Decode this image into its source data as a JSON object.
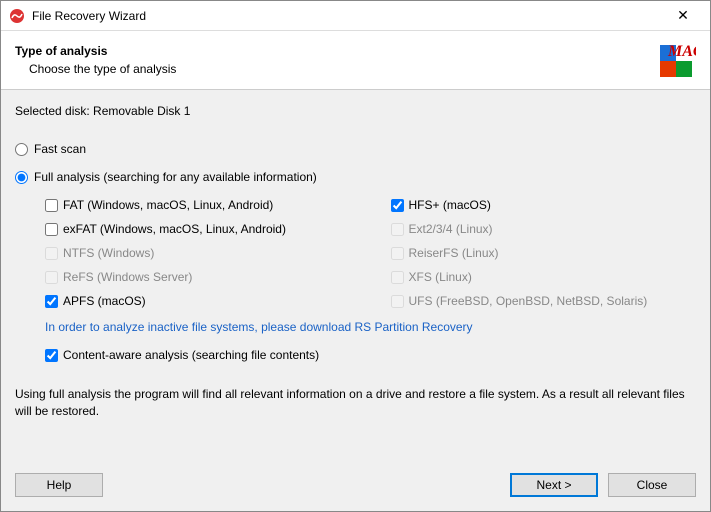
{
  "window": {
    "title": "File Recovery Wizard",
    "close_glyph": "✕"
  },
  "header": {
    "title": "Type of analysis",
    "subtitle": "Choose the type of analysis"
  },
  "selected_disk_label": "Selected disk: Removable Disk 1",
  "scan": {
    "fast_label": "Fast scan",
    "full_label": "Full analysis (searching for any available information)"
  },
  "filesystems": [
    {
      "label": "FAT (Windows, macOS, Linux, Android)",
      "checked": false,
      "disabled": false
    },
    {
      "label": "HFS+ (macOS)",
      "checked": true,
      "disabled": false
    },
    {
      "label": "exFAT (Windows, macOS, Linux, Android)",
      "checked": false,
      "disabled": false
    },
    {
      "label": "Ext2/3/4 (Linux)",
      "checked": false,
      "disabled": true
    },
    {
      "label": "NTFS (Windows)",
      "checked": false,
      "disabled": true
    },
    {
      "label": "ReiserFS (Linux)",
      "checked": false,
      "disabled": true
    },
    {
      "label": "ReFS (Windows Server)",
      "checked": false,
      "disabled": true
    },
    {
      "label": "XFS (Linux)",
      "checked": false,
      "disabled": true
    },
    {
      "label": "APFS (macOS)",
      "checked": true,
      "disabled": false
    },
    {
      "label": "UFS (FreeBSD, OpenBSD, NetBSD, Solaris)",
      "checked": false,
      "disabled": true
    }
  ],
  "download_link": "In order to analyze inactive file systems, please download RS Partition Recovery",
  "content_aware_label": "Content-aware analysis (searching file contents)",
  "description": "Using full analysis the program will find all relevant information on a drive and restore a file system. As a result all relevant files will be restored.",
  "buttons": {
    "help": "Help",
    "next": "Next >",
    "close": "Close"
  }
}
